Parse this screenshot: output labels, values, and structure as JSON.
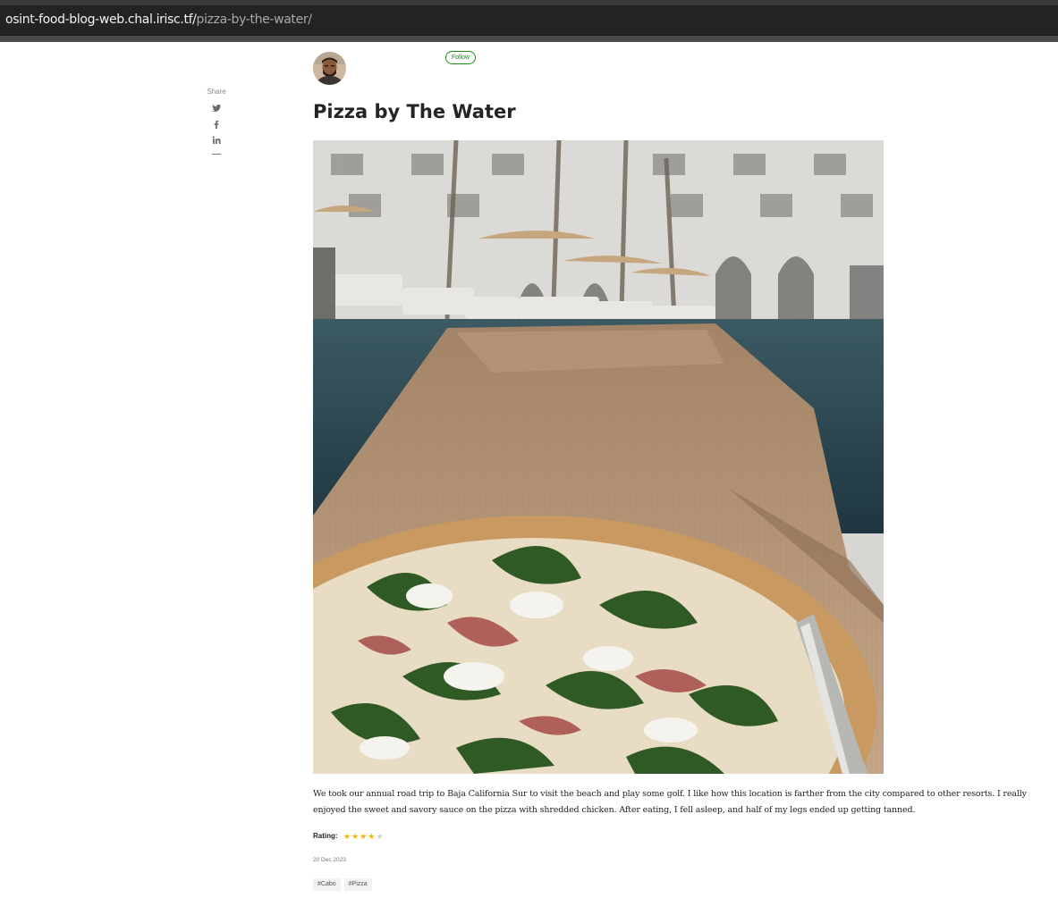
{
  "browser": {
    "url_host": "osint-food-blog-web.chal.irisc.tf/",
    "url_path": "pizza-by-the-water/"
  },
  "share": {
    "label": "Share",
    "icons": [
      "twitter-icon",
      "facebook-icon",
      "linkedin-icon"
    ]
  },
  "author": {
    "avatar_icon": "avatar",
    "follow_label": "Follow"
  },
  "article": {
    "title": "Pizza by The Water",
    "body": "We took our annual road trip to Baja California Sur to visit the beach and play some golf. I like how this location is farther from the city compared to other resorts. I really enjoyed the sweet and savory sauce on the pizza with shredded chicken. After eating, I fell asleep, and half of my legs ended up getting tanned.",
    "rating_label": "Rating:",
    "rating_value": 4,
    "rating_max": 5,
    "date": "20 Dec 2023",
    "tags": [
      "#Cabo",
      "#Pizza"
    ]
  },
  "colors": {
    "accent": "#1a8917",
    "star": "#f4b400",
    "url_bar": "#232323"
  }
}
